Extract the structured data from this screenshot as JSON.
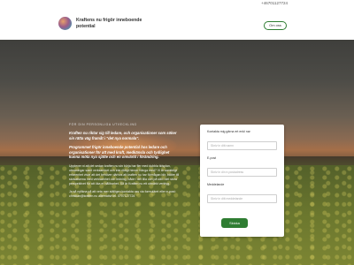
{
  "topbar": {
    "phone": "+46701127724"
  },
  "header": {
    "brand": "Kraftens nu frigör inneboende potential",
    "button_label": "Om oss"
  },
  "hero": {
    "eyebrow": "FÖR DIN PERSONLIGA UTVECKLING",
    "lead": "Kraften nu riktar sig till ledare, och organisationer som söker sin rätta väg framåt i \"det nya normala\".",
    "lead2": "Programmet frigör inneboende potential hos ledare och organisationer för att med kraft, medkänsla och tydlighet kunna möta nya sjätte och en omvärld i förändring.",
    "para1": "Upplever ni att det sedan kraften nu sin börja har fler med dubbla tidsplan, utmaningar samt verksamhet och inte riktigt hinner hänga med? Vi är samtidigt erfarenhet visar att det behöver därhos att kraften nu har förmågan blir, bättre till slutsatserna med verksamhet och ledning, både i det lilla och på sikt i det stora perspektivet för att öka er hållbarhet. Så är Kraften nu ett utmärkt verktyg.",
    "para2": "Ja så nyfikna på att veta mer ställigen kontakta oss via formuläret eller e-post: christian@kraften.nu alternativt tel. 0707127724"
  },
  "form": {
    "name_label": "Kontakta mig gärna ert enkl nar",
    "name_placeholder": "Skriv in ditt namn",
    "email_label": "E-post",
    "email_placeholder": "Skriv in din e-postadress",
    "message_label": "Meddelande",
    "message_placeholder": "Skriv in ditt meddelande",
    "submit_label": "Skicka"
  },
  "colors": {
    "accent": "#2f7d32"
  }
}
